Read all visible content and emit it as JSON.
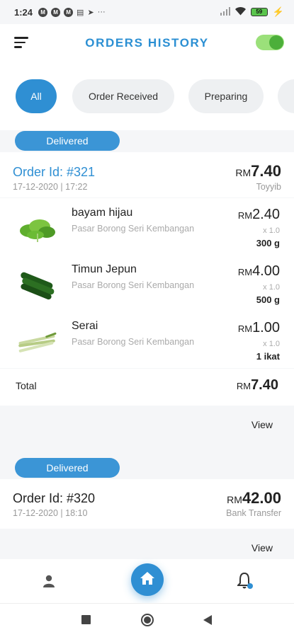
{
  "status": {
    "time": "1:24",
    "battery": "59"
  },
  "appbar": {
    "title": "ORDERS HISTORY"
  },
  "filters": [
    {
      "label": "All",
      "active": true
    },
    {
      "label": "Order Received",
      "active": false
    },
    {
      "label": "Preparing",
      "active": false
    }
  ],
  "orders": [
    {
      "status": "Delivered",
      "id": "Order Id: #321",
      "date": "17-12-2020 | 17:22",
      "currency": "RM",
      "amount": "7.40",
      "payment": "Toyyib",
      "items": [
        {
          "name": "bayam hijau",
          "market": "Pasar Borong Seri Kembangan",
          "currency": "RM",
          "price": "2.40",
          "qty": "x 1.0",
          "weight": "300 g",
          "image_icon": "spinach-icon"
        },
        {
          "name": "Timun Jepun",
          "market": "Pasar Borong Seri Kembangan",
          "currency": "RM",
          "price": "4.00",
          "qty": "x 1.0",
          "weight": "500 g",
          "image_icon": "cucumber-icon"
        },
        {
          "name": "Serai",
          "market": "Pasar Borong Seri Kembangan",
          "currency": "RM",
          "price": "1.00",
          "qty": "x 1.0",
          "weight": "1 ikat",
          "image_icon": "lemongrass-icon"
        }
      ],
      "total_label": "Total",
      "total_currency": "RM",
      "total": "7.40",
      "view_label": "View"
    },
    {
      "status": "Delivered",
      "id": "Order Id: #320",
      "date": "17-12-2020 | 18:10",
      "currency": "RM",
      "amount": "42.00",
      "payment": "Bank Transfer",
      "view_label": "View"
    }
  ],
  "colors": {
    "accent": "#2f8fd3",
    "toggle": "#4caf3a",
    "badge": "#3b95d6"
  }
}
